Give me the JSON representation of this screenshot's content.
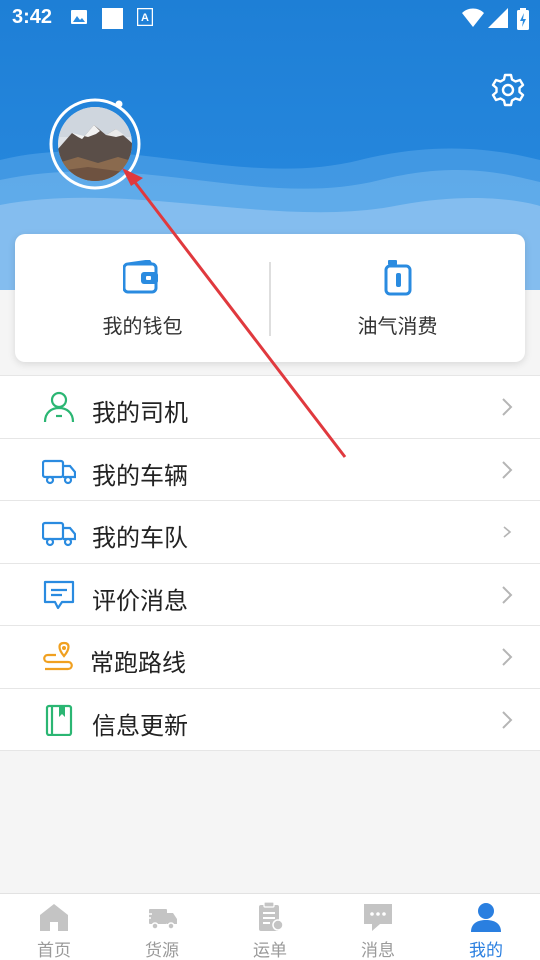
{
  "status_bar": {
    "time": "3:42"
  },
  "profile": {
    "settings_icon": "gear-icon",
    "avatar_alt": "avatar"
  },
  "quick_actions": [
    {
      "label": "我的钱包",
      "icon": "wallet-icon"
    },
    {
      "label": "油气消费",
      "icon": "fuel-card-icon"
    }
  ],
  "menu": [
    {
      "label": "我的司机",
      "icon": "driver-icon",
      "color": "#2bb673"
    },
    {
      "label": "我的车辆",
      "icon": "truck-icon",
      "color": "#2a8be0"
    },
    {
      "label": "我的车队",
      "icon": "truck-icon",
      "color": "#2a8be0"
    },
    {
      "label": "评价消息",
      "icon": "comment-icon",
      "color": "#2a8be0"
    },
    {
      "label": "常跑路线",
      "icon": "route-icon",
      "color": "#f0a020"
    },
    {
      "label": "信息更新",
      "icon": "book-icon",
      "color": "#2bb673"
    }
  ],
  "tabs": [
    {
      "label": "首页",
      "icon": "home-icon"
    },
    {
      "label": "货源",
      "icon": "cargo-truck-icon"
    },
    {
      "label": "运单",
      "icon": "waybill-icon"
    },
    {
      "label": "消息",
      "icon": "message-icon"
    },
    {
      "label": "我的",
      "icon": "user-icon",
      "active": true
    }
  ],
  "colors": {
    "primary": "#2a8be0",
    "annotation_arrow": "#e0393e"
  }
}
